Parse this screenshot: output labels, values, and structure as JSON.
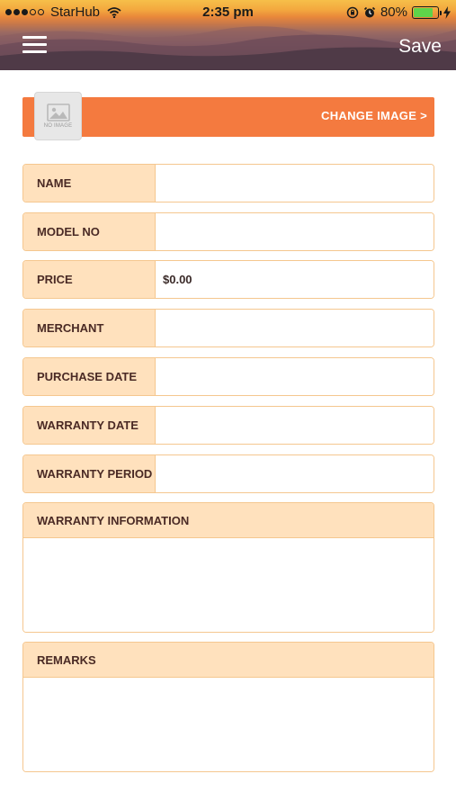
{
  "status_bar": {
    "carrier": "StarHub",
    "time": "2:35 pm",
    "battery": "80%",
    "battery_level": 0.8,
    "signal_filled": 3,
    "signal_total": 5
  },
  "nav": {
    "menu_icon": "hamburger-menu-icon",
    "save_label": "Save"
  },
  "image": {
    "placeholder_text": "NO IMAGE",
    "change_label": "CHANGE IMAGE >"
  },
  "colors": {
    "accent": "#f47a3f",
    "label_bg": "#ffe1bd",
    "border": "#f5c78f",
    "label_text": "#4a2a25"
  },
  "fields": {
    "name": {
      "label": "NAME",
      "value": ""
    },
    "model_no": {
      "label": "MODEL NO",
      "value": ""
    },
    "price": {
      "label": "PRICE",
      "value": "$0.00"
    },
    "merchant": {
      "label": "MERCHANT",
      "value": ""
    },
    "purchase_date": {
      "label": "PURCHASE DATE",
      "value": ""
    },
    "warranty_date": {
      "label": "WARRANTY DATE",
      "value": ""
    },
    "warranty_period": {
      "label": "WARRANTY PERIOD",
      "value": ""
    }
  },
  "warranty_information": {
    "label": "WARRANTY INFORMATION",
    "value": ""
  },
  "remarks": {
    "label": "REMARKS",
    "value": ""
  }
}
